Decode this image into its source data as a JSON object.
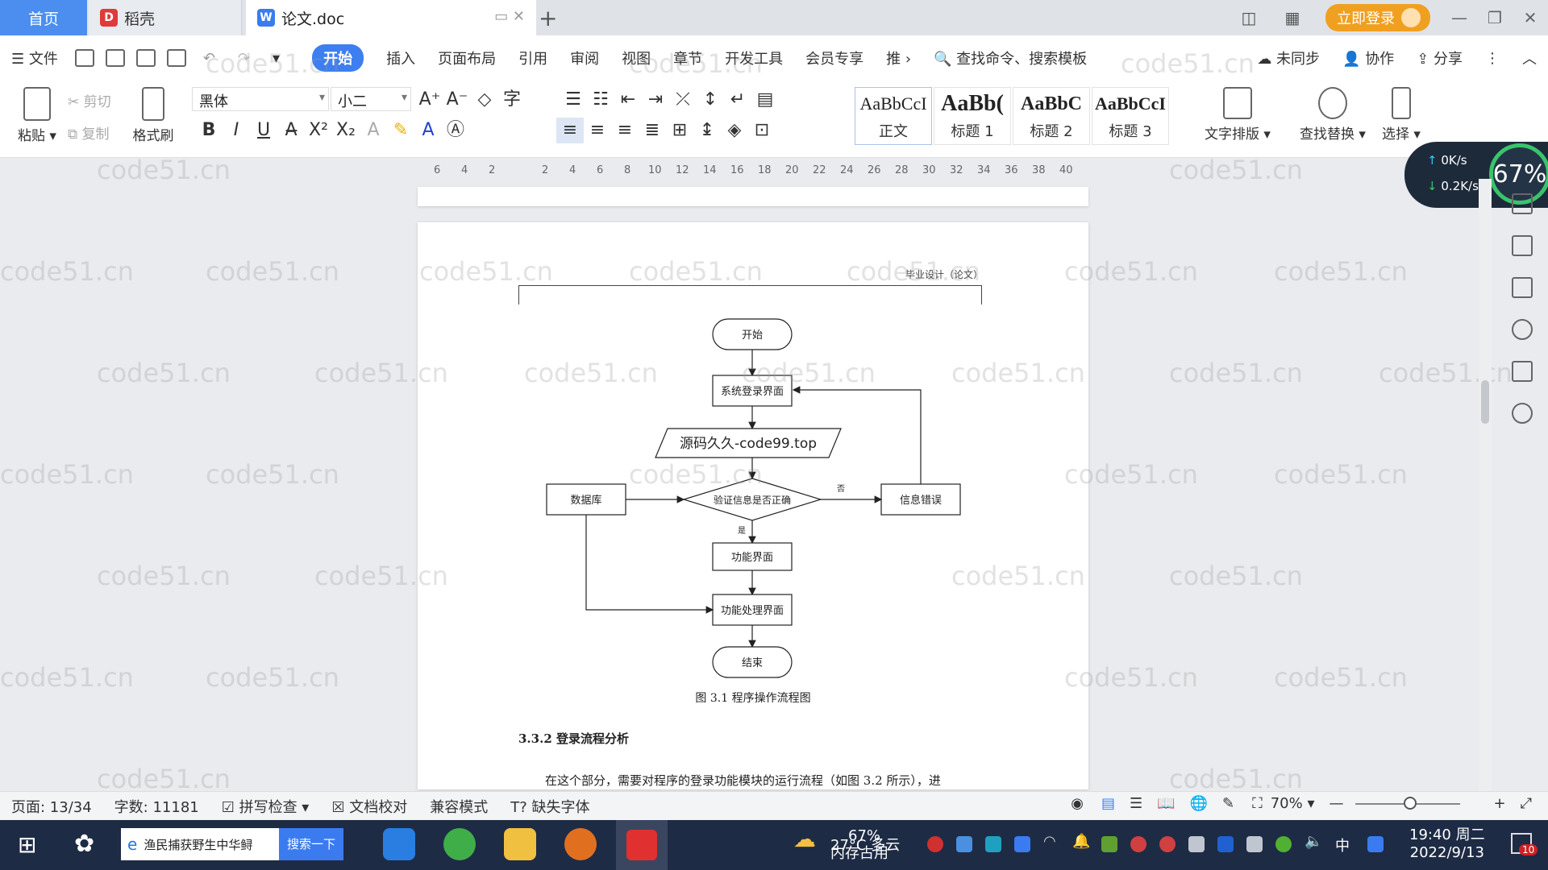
{
  "tabs": {
    "home": "首页",
    "daoke": "稻壳",
    "doc": "论文.doc"
  },
  "title_right": {
    "login": "立即登录"
  },
  "menu": {
    "file": "文件",
    "items": [
      "开始",
      "插入",
      "页面布局",
      "引用",
      "审阅",
      "视图",
      "章节",
      "开发工具",
      "会员专享",
      "推"
    ],
    "search_cmd": "查找命令、搜索模板",
    "sync": "未同步",
    "collab": "协作",
    "share": "分享"
  },
  "ribbon": {
    "paste": "粘贴",
    "cut": "剪切",
    "copy": "复制",
    "format_painter": "格式刷",
    "font": "黑体",
    "size": "小二",
    "styles": [
      {
        "preview": "AaBbCcI",
        "label": "正文"
      },
      {
        "preview": "AaBb(",
        "label": "标题 1"
      },
      {
        "preview": "AaBbC",
        "label": "标题 2"
      },
      {
        "preview": "AaBbCcI",
        "label": "标题 3"
      }
    ],
    "text_layout": "文字排版",
    "find_replace": "查找替换",
    "select": "选择"
  },
  "ruler": [
    "6",
    "4",
    "2",
    "2",
    "4",
    "6",
    "8",
    "10",
    "12",
    "14",
    "16",
    "18",
    "20",
    "22",
    "24",
    "26",
    "28",
    "30",
    "32",
    "34",
    "36",
    "38",
    "40"
  ],
  "speed": {
    "up": "0K/s",
    "down": "0.2K/s",
    "percent": "67%"
  },
  "document": {
    "header": "毕业设计（论文）",
    "flow": {
      "start": "开始",
      "login": "系统登录界面",
      "input_overlay": "源码久久-code99.top",
      "verify": "验证信息是否正确",
      "db": "数据库",
      "error": "信息错误",
      "no": "否",
      "yes": "是",
      "func": "功能界面",
      "process": "功能处理界面",
      "end": "结束"
    },
    "caption": "图 3.1  程序操作流程图",
    "section": "3.3.2  登录流程分析",
    "paragraph": "在这个部分，需要对程序的登录功能模块的运行流程（如图 3.2 所示），进"
  },
  "watermark": "code51.cn",
  "status": {
    "page": "页面: 13/34",
    "words": "字数: 11181",
    "spell": "拼写检查",
    "proof": "文档校对",
    "compat": "兼容模式",
    "missing_font": "缺失字体",
    "zoom": "70%"
  },
  "taskbar": {
    "search": "渔民捕获野生中华鲟",
    "search_btn": "搜索一下",
    "weather_temp": "27°C 多云",
    "mem": "67%",
    "mem_label": "内存占用",
    "ime": "中",
    "time": "19:40 周二",
    "date": "2022/9/13",
    "notif": "10"
  },
  "colors": {
    "accent": "#3d7ff0",
    "login": "#f0a020",
    "taskbar": "#1e2b45"
  }
}
